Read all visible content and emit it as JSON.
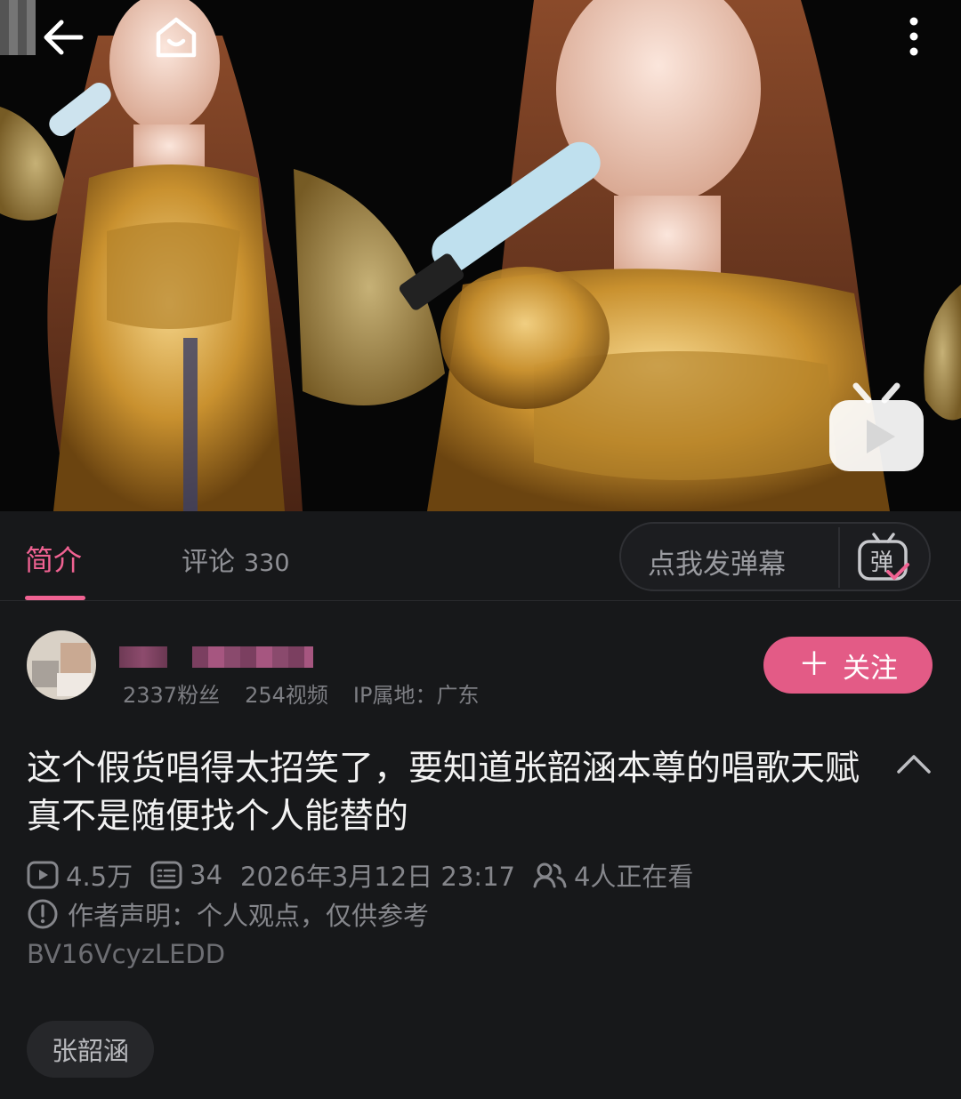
{
  "tabs": {
    "intro_label": "简介",
    "comments_label": "评论",
    "comments_count": "330"
  },
  "danmaku": {
    "placeholder": "点我发弹幕",
    "icon_text": "弹"
  },
  "uploader": {
    "fans": "2337粉丝",
    "videos": "254视频",
    "ip_location": "IP属地：广东",
    "follow_label": "关注"
  },
  "video_info": {
    "title": "这个假货唱得太招笑了，要知道张韶涵本尊的唱歌天赋真不是随便找个人能替的",
    "plays": "4.5万",
    "danmaku_count": "34",
    "publish_time": "2026年3月12日 23:17",
    "watching_now": "4人正在看",
    "author_declaration": "作者声明：个人观点，仅供参考",
    "bvid": "BV16VcyzLEDD",
    "tags": [
      "张韶涵"
    ]
  },
  "icons": {
    "back": "back-arrow-icon",
    "home": "home-icon",
    "more": "more-vertical-icon",
    "player_logo": "bilibili-tv-icon",
    "danmaku_toggle": "danmaku-toggle-icon",
    "collapse": "chevron-up-icon",
    "play_count": "play-icon",
    "danmaku_count": "danmaku-count-icon",
    "watching": "viewers-icon",
    "declaration": "info-icon"
  },
  "colors": {
    "accent": "#f06292",
    "follow_button": "#e35b86",
    "background": "#17181a"
  }
}
